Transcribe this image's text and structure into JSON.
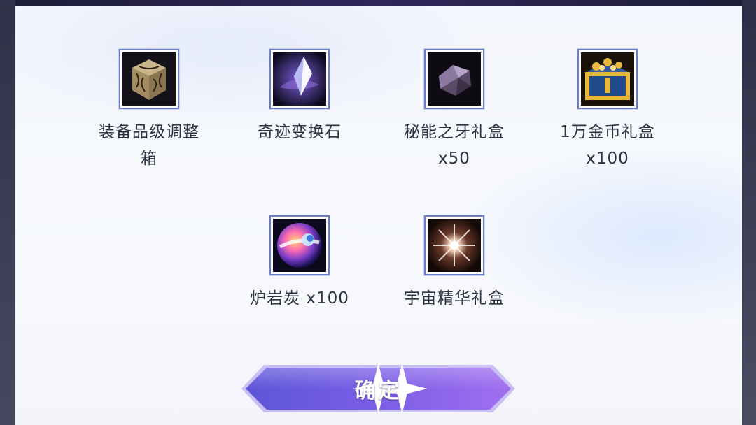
{
  "dialog": {
    "rewards": [
      {
        "name_line1": "装备品级调整",
        "name_line2": "箱",
        "icon": "equipment-box-icon"
      },
      {
        "name_line1": "奇迹变换石",
        "name_line2": "",
        "icon": "miracle-crystal-icon"
      },
      {
        "name_line1": "秘能之牙礼盒",
        "name_line2": "x50",
        "icon": "fang-gift-box-icon"
      },
      {
        "name_line1": "1万金币礼盒",
        "name_line2": "x100",
        "icon": "gold-chest-icon"
      },
      {
        "name_line1": "炉岩炭 x100",
        "name_line2": "",
        "icon": "lava-orb-icon"
      },
      {
        "name_line1": "宇宙精华礼盒",
        "name_line2": "",
        "icon": "cosmic-essence-icon"
      }
    ],
    "confirm_label": "确定"
  },
  "colors": {
    "panel_bg": "#f5f7fc",
    "icon_border": "#6a7cc4",
    "button_gradient_start": "#6f5ce0",
    "button_gradient_end": "#9a6cf0",
    "text": "#2e3140"
  }
}
